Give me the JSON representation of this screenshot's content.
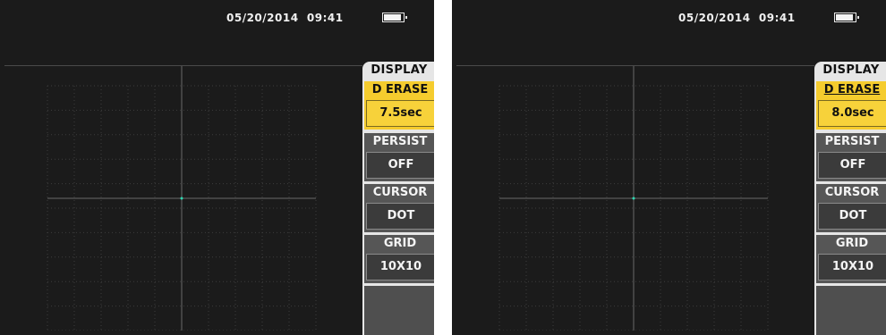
{
  "screens": [
    {
      "datetime": "05/20/2014  09:41",
      "menu": {
        "title": "DISPLAY",
        "params": [
          {
            "label": "D ERASE",
            "value": "7.5sec"
          },
          {
            "label": "PERSIST",
            "value": "OFF"
          },
          {
            "label": "CURSOR",
            "value": "DOT"
          },
          {
            "label": "GRID",
            "value": "10X10"
          }
        ]
      }
    },
    {
      "datetime": "05/20/2014  09:41",
      "menu": {
        "title": "DISPLAY",
        "params": [
          {
            "label": "D ERASE",
            "value": "8.0sec"
          },
          {
            "label": "PERSIST",
            "value": "OFF"
          },
          {
            "label": "CURSOR",
            "value": "DOT"
          },
          {
            "label": "GRID",
            "value": "10X10"
          }
        ]
      }
    }
  ],
  "battery_level": 0.9,
  "icons": [
    "battery-icon"
  ],
  "colors": {
    "screen_background": "#1b1b1b",
    "active_param": "#f5cc2e",
    "param_panel": "#565656",
    "menu_panel": "#e6e6e6",
    "cursor_dot": "#2fd6b0"
  }
}
